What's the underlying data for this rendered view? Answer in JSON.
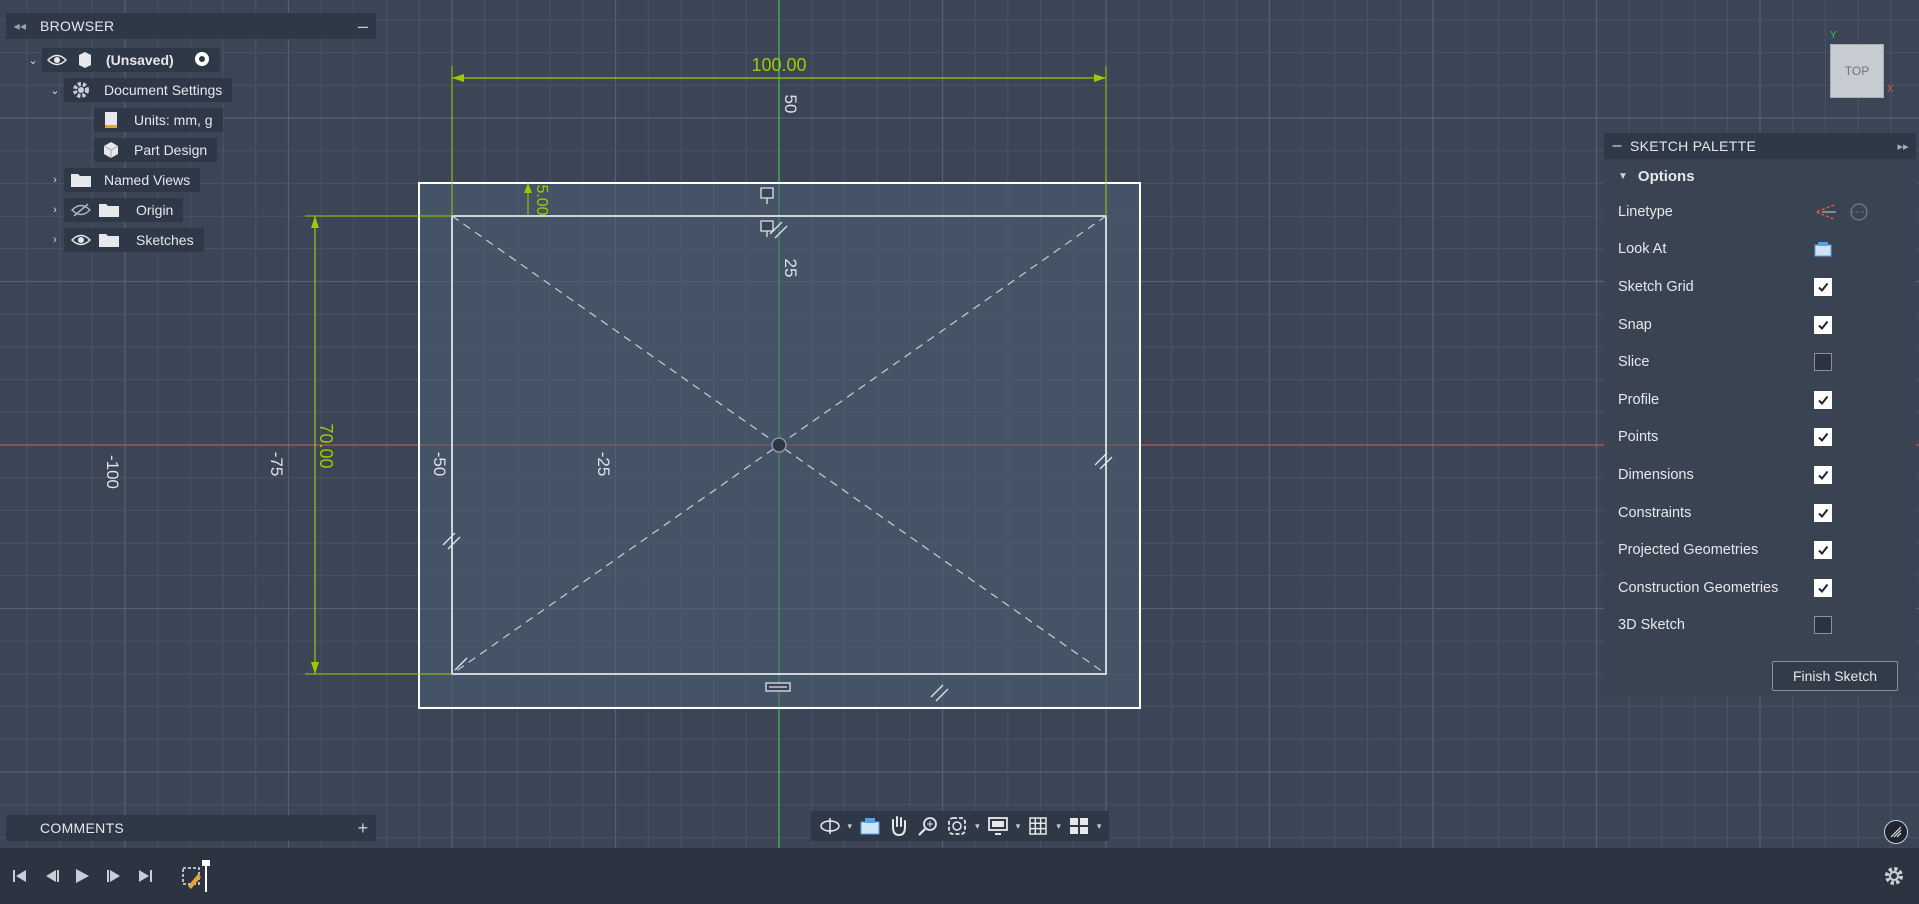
{
  "browser": {
    "title": "BROWSER",
    "root": {
      "label": "(Unsaved)"
    },
    "items": [
      {
        "label": "Document Settings"
      },
      {
        "label": "Units: mm, g"
      },
      {
        "label": "Part Design"
      },
      {
        "label": "Named Views"
      },
      {
        "label": "Origin"
      },
      {
        "label": "Sketches"
      }
    ]
  },
  "comments": {
    "title": "COMMENTS"
  },
  "viewcube": {
    "face_label": "TOP",
    "axis_y": "Y",
    "axis_x": "X"
  },
  "canvas": {
    "dims": {
      "width": "100.00",
      "height": "70.00",
      "offset": "5.00"
    },
    "axis_labels": {
      "y_50": "50",
      "y_25": "25",
      "x_neg100": "-100",
      "x_neg75": "-75",
      "x_neg50": "-50",
      "x_neg25": "-25"
    },
    "colors": {
      "background": "#3b4555",
      "grid_minor": "#4a5465",
      "grid_major": "#566173",
      "dimension": "#9ccc00",
      "x_axis": "#c0504d",
      "y_axis": "#3fbf5a",
      "sketch_line": "#ffffff",
      "profile_fill": "#4d5f75"
    }
  },
  "palette": {
    "title": "SKETCH PALETTE",
    "options_label": "Options",
    "rows": [
      {
        "label": "Linetype",
        "control": "linetype-icons"
      },
      {
        "label": "Look At",
        "control": "look-at-icon"
      },
      {
        "label": "Sketch Grid",
        "checked": true
      },
      {
        "label": "Snap",
        "checked": true
      },
      {
        "label": "Slice",
        "checked": false
      },
      {
        "label": "Profile",
        "checked": true
      },
      {
        "label": "Points",
        "checked": true
      },
      {
        "label": "Dimensions",
        "checked": true
      },
      {
        "label": "Constraints",
        "checked": true
      },
      {
        "label": "Projected Geometries",
        "checked": true
      },
      {
        "label": "Construction Geometries",
        "checked": true
      },
      {
        "label": "3D Sketch",
        "checked": false
      }
    ],
    "finish_label": "Finish Sketch"
  },
  "navbar": {
    "icons": [
      "orbit-icon",
      "look-at-icon",
      "pan-icon",
      "zoom-icon",
      "fit-icon",
      "display-settings-icon",
      "grid-icon",
      "viewports-icon"
    ]
  },
  "timeline": {
    "icons": [
      "first-icon",
      "previous-icon",
      "play-icon",
      "next-icon",
      "last-icon",
      "sketch-feature-icon",
      "settings-icon"
    ]
  }
}
